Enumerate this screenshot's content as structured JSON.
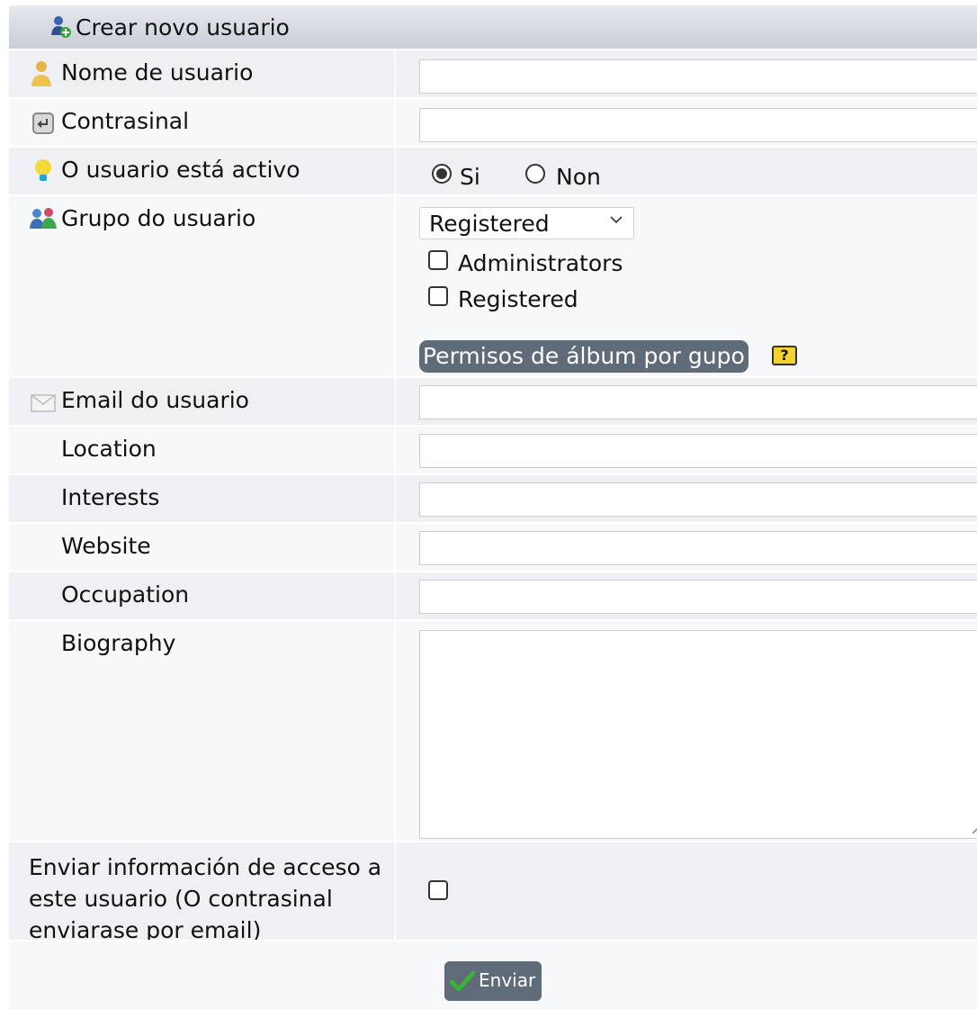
{
  "form": {
    "title": "Crear novo usuario",
    "username_label": "Nome de usuario",
    "username_value": "",
    "password_label": "Contrasinal",
    "password_value": "",
    "active_label": "O usuario está activo",
    "active_yes": "Si",
    "active_no": "Non",
    "active_selected": "Si",
    "group_label": "Grupo do usuario",
    "group_selected": "Registered",
    "group_checkboxes": [
      "Administrators",
      "Registered"
    ],
    "album_perm_button": "Permisos de álbum por gupo",
    "help_label": "?",
    "email_label": "Email do usuario",
    "email_value": "",
    "location_label": "Location",
    "location_value": "",
    "interests_label": "Interests",
    "interests_value": "",
    "website_label": "Website",
    "website_value": "",
    "occupation_label": "Occupation",
    "occupation_value": "",
    "biography_label": "Biography",
    "biography_value": "",
    "send_info_label": "Enviar información de acceso a este usuario (O contrasinal enviarase por email)",
    "submit_label": "Enviar"
  },
  "icons": {
    "title": "user-add-icon",
    "username": "user-icon",
    "password": "key-icon",
    "active": "lightbulb-icon",
    "group": "group-icon",
    "email": "envelope-icon",
    "submit": "checkmark-icon"
  },
  "colors": {
    "header": "#c9ced6",
    "row_shade": "#eef0f3",
    "button": "#5f6b78",
    "help": "#f4d32c",
    "check": "#3bb13b"
  }
}
